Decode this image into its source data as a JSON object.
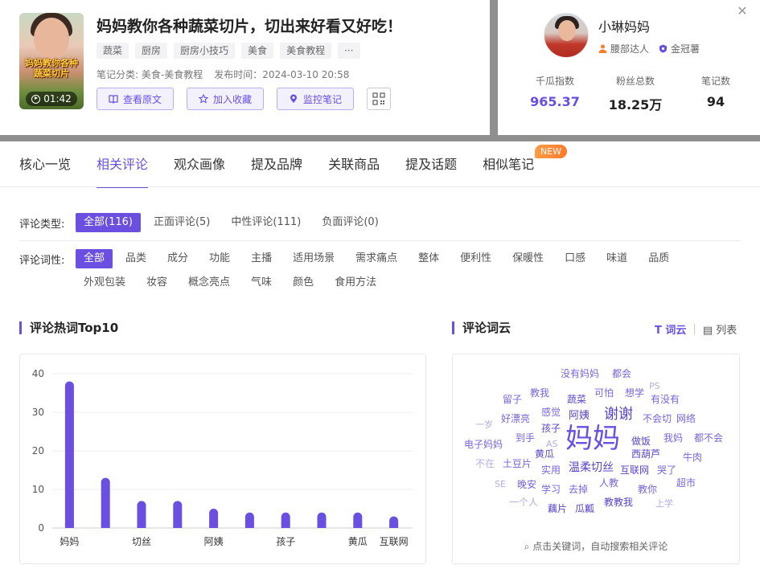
{
  "note": {
    "thumb_caption": "妈妈教你各种蔬菜切片",
    "duration": "01:42",
    "title": "妈妈教你各种蔬菜切片，切出来好看又好吃！",
    "tags": [
      "蔬菜",
      "厨房",
      "厨房小技巧",
      "美食",
      "美食教程",
      "···"
    ],
    "category": "笔记分类: 美食-美食教程",
    "publish_time": "发布时间：2024-03-10 20:58",
    "actions": {
      "view_original": "查看原文",
      "add_favorite": "加入收藏",
      "monitor": "监控笔记"
    }
  },
  "author": {
    "name": "小琳妈妈",
    "badge_1": "腰部达人",
    "badge_2": "金冠薯",
    "stats": [
      {
        "label": "千瓜指数",
        "value": "965.37"
      },
      {
        "label": "粉丝总数",
        "value": "18.25万"
      },
      {
        "label": "笔记数",
        "value": "94"
      }
    ]
  },
  "tabs": [
    "核心一览",
    "相关评论",
    "观众画像",
    "提及品牌",
    "关联商品",
    "提及话题",
    "相似笔记"
  ],
  "new_badge": "NEW",
  "filters": {
    "type_label": "评论类型:",
    "type_options": [
      "全部(116)",
      "正面评论(5)",
      "中性评论(111)",
      "负面评论(0)"
    ],
    "attr_label": "评论词性:",
    "attr_row1": [
      "全部",
      "品类",
      "成分",
      "功能",
      "主播",
      "适用场景",
      "需求痛点",
      "整体",
      "便利性",
      "保暖性",
      "口感",
      "味道",
      "品质"
    ],
    "attr_row2": [
      "外观包装",
      "妆容",
      "概念亮点",
      "气味",
      "颜色",
      "食用方法"
    ]
  },
  "sections": {
    "top10": "评论热词Top10",
    "cloud": "评论词云"
  },
  "view_switch": {
    "cloud": "词云",
    "list": "列表"
  },
  "chart_data": {
    "type": "bar",
    "categories": [
      "妈妈",
      "",
      "切丝",
      "",
      "阿姨",
      "",
      "孩子",
      "",
      "黄瓜",
      "互联网"
    ],
    "values": [
      38,
      13,
      7,
      7,
      5,
      4,
      4,
      4,
      4,
      3
    ],
    "yticks": [
      "0",
      "10",
      "20",
      "30",
      "40"
    ],
    "ylim": [
      0,
      40
    ],
    "bar_color": "#6a4fe0"
  },
  "word_cloud": {
    "words": [
      "没有妈妈",
      "都会",
      "PS",
      "留子",
      "教我",
      "蔬菜",
      "可怕",
      "想学",
      "有没有",
      "一岁",
      "好漂亮",
      "感觉",
      "阿姨",
      "谢谢",
      "不会切",
      "网络",
      "孩子",
      "电子妈妈",
      "到手",
      "AS",
      "妈妈",
      "做饭",
      "我妈",
      "都不会",
      "黄瓜",
      "西葫芦",
      "牛肉",
      "不在",
      "土豆片",
      "实用",
      "温柔切丝",
      "互联网",
      "哭了",
      "SE",
      "晚安",
      "人教",
      "超市",
      "学习",
      "去掉",
      "教你",
      "一个人",
      "上学",
      "藕片",
      "瓜瓤",
      "教教我"
    ],
    "hint": "点击关键词，自动搜索相关评论"
  },
  "colors": {
    "accent": "#6a4fe0",
    "orange": "#ff7a2a"
  }
}
